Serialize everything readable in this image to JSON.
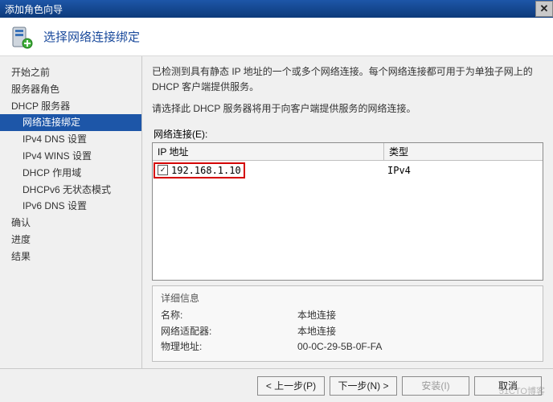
{
  "window": {
    "title": "添加角色向导"
  },
  "header": {
    "title": "选择网络连接绑定"
  },
  "sidebar": {
    "items": [
      {
        "label": "开始之前",
        "sub": false,
        "selected": false
      },
      {
        "label": "服务器角色",
        "sub": false,
        "selected": false
      },
      {
        "label": "DHCP 服务器",
        "sub": false,
        "selected": false
      },
      {
        "label": "网络连接绑定",
        "sub": true,
        "selected": true
      },
      {
        "label": "IPv4 DNS 设置",
        "sub": true,
        "selected": false
      },
      {
        "label": "IPv4 WINS 设置",
        "sub": true,
        "selected": false
      },
      {
        "label": "DHCP 作用域",
        "sub": true,
        "selected": false
      },
      {
        "label": "DHCPv6 无状态模式",
        "sub": true,
        "selected": false
      },
      {
        "label": "IPv6 DNS 设置",
        "sub": true,
        "selected": false
      },
      {
        "label": "确认",
        "sub": false,
        "selected": false
      },
      {
        "label": "进度",
        "sub": false,
        "selected": false
      },
      {
        "label": "结果",
        "sub": false,
        "selected": false
      }
    ]
  },
  "content": {
    "desc1": "已检测到具有静态 IP 地址的一个或多个网络连接。每个网络连接都可用于为单独子网上的 DHCP 客户端提供服务。",
    "desc2": "请选择此 DHCP 服务器将用于向客户端提供服务的网络连接。",
    "group_label": "网络连接(E):",
    "columns": {
      "ip": "IP 地址",
      "type": "类型"
    },
    "rows": [
      {
        "checked": true,
        "ip": "192.168.1.10",
        "type": "IPv4"
      }
    ],
    "details": {
      "heading": "详细信息",
      "name_label": "名称:",
      "name_value": "本地连接",
      "adapter_label": "网络适配器:",
      "adapter_value": "本地连接",
      "mac_label": "物理地址:",
      "mac_value": "00-0C-29-5B-0F-FA"
    }
  },
  "footer": {
    "prev": "< 上一步(P)",
    "next": "下一步(N) >",
    "install": "安装(I)",
    "cancel": "取消"
  },
  "watermark": "51CTO博客"
}
